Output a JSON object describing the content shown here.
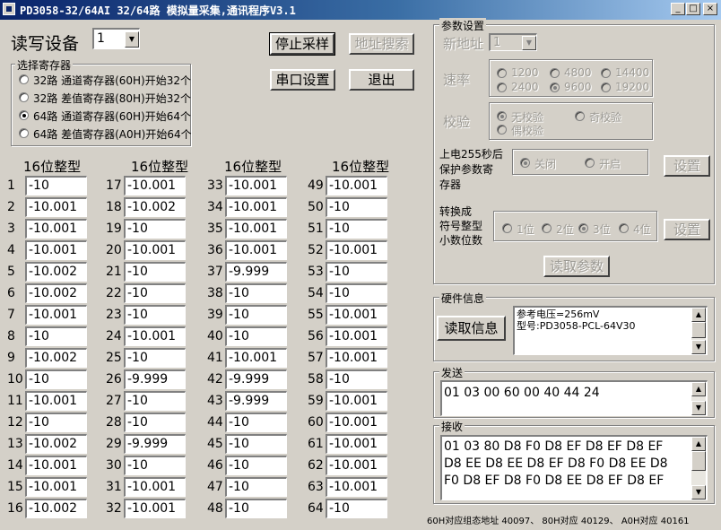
{
  "window": {
    "title": "PD3058-32/64AI 32/64路 模拟量采集,通讯程序V3.1",
    "min_label": "_",
    "max_label": "□",
    "close_label": "×"
  },
  "device": {
    "label": "读写设备",
    "value": "1"
  },
  "buttons": {
    "stop": "停止采样",
    "search": "地址搜索",
    "serial": "串口设置",
    "exit": "退出"
  },
  "register_group": {
    "title": "选择寄存器",
    "options": [
      "32路 通道寄存器(60H)开始32个",
      "32路 差值寄存器(80H)开始32个",
      "64路 通道寄存器(60H)开始64个",
      "64路 差值寄存器(A0H)开始64个"
    ],
    "selected_index": 2
  },
  "channels": {
    "header": "16位整型",
    "columns": [
      {
        "rows": [
          {
            "n": "1",
            "v": "-10"
          },
          {
            "n": "2",
            "v": "-10.001"
          },
          {
            "n": "3",
            "v": "-10.001"
          },
          {
            "n": "4",
            "v": "-10.001"
          },
          {
            "n": "5",
            "v": "-10.002"
          },
          {
            "n": "6",
            "v": "-10.002"
          },
          {
            "n": "7",
            "v": "-10.001"
          },
          {
            "n": "8",
            "v": "-10"
          },
          {
            "n": "9",
            "v": "-10.002"
          },
          {
            "n": "10",
            "v": "-10"
          },
          {
            "n": "11",
            "v": "-10.001"
          },
          {
            "n": "12",
            "v": "-10"
          },
          {
            "n": "13",
            "v": "-10.002"
          },
          {
            "n": "14",
            "v": "-10.001"
          },
          {
            "n": "15",
            "v": "-10.001"
          },
          {
            "n": "16",
            "v": "-10.002"
          }
        ]
      },
      {
        "rows": [
          {
            "n": "17",
            "v": "-10.001"
          },
          {
            "n": "18",
            "v": "-10.002"
          },
          {
            "n": "19",
            "v": "-10"
          },
          {
            "n": "20",
            "v": "-10.001"
          },
          {
            "n": "21",
            "v": "-10"
          },
          {
            "n": "22",
            "v": "-10"
          },
          {
            "n": "23",
            "v": "-10"
          },
          {
            "n": "24",
            "v": "-10.001"
          },
          {
            "n": "25",
            "v": "-10"
          },
          {
            "n": "26",
            "v": "-9.999"
          },
          {
            "n": "27",
            "v": "-10"
          },
          {
            "n": "28",
            "v": "-10"
          },
          {
            "n": "29",
            "v": "-9.999"
          },
          {
            "n": "30",
            "v": "-10"
          },
          {
            "n": "31",
            "v": "-10.001"
          },
          {
            "n": "32",
            "v": "-10.001"
          }
        ]
      },
      {
        "rows": [
          {
            "n": "33",
            "v": "-10.001"
          },
          {
            "n": "34",
            "v": "-10.001"
          },
          {
            "n": "35",
            "v": "-10.001"
          },
          {
            "n": "36",
            "v": "-10.001"
          },
          {
            "n": "37",
            "v": "-9.999"
          },
          {
            "n": "38",
            "v": "-10"
          },
          {
            "n": "39",
            "v": "-10"
          },
          {
            "n": "40",
            "v": "-10"
          },
          {
            "n": "41",
            "v": "-10.001"
          },
          {
            "n": "42",
            "v": "-9.999"
          },
          {
            "n": "43",
            "v": "-9.999"
          },
          {
            "n": "44",
            "v": "-10"
          },
          {
            "n": "45",
            "v": "-10"
          },
          {
            "n": "46",
            "v": "-10"
          },
          {
            "n": "47",
            "v": "-10"
          },
          {
            "n": "48",
            "v": "-10"
          }
        ]
      },
      {
        "rows": [
          {
            "n": "49",
            "v": "-10.001"
          },
          {
            "n": "50",
            "v": "-10"
          },
          {
            "n": "51",
            "v": "-10"
          },
          {
            "n": "52",
            "v": "-10.001"
          },
          {
            "n": "53",
            "v": "-10"
          },
          {
            "n": "54",
            "v": "-10"
          },
          {
            "n": "55",
            "v": "-10.001"
          },
          {
            "n": "56",
            "v": "-10.001"
          },
          {
            "n": "57",
            "v": "-10.001"
          },
          {
            "n": "58",
            "v": "-10"
          },
          {
            "n": "59",
            "v": "-10.001"
          },
          {
            "n": "60",
            "v": "-10.001"
          },
          {
            "n": "61",
            "v": "-10.001"
          },
          {
            "n": "62",
            "v": "-10.001"
          },
          {
            "n": "63",
            "v": "-10.001"
          },
          {
            "n": "64",
            "v": "-10"
          }
        ]
      }
    ]
  },
  "params": {
    "title": "参数设置",
    "new_addr_label": "新地址",
    "new_addr_value": "1",
    "baud_label": "速率",
    "baud_options": [
      "1200",
      "4800",
      "14400",
      "2400",
      "9600",
      "19200"
    ],
    "baud_selected": "9600",
    "check_label": "校验",
    "check_options": [
      "无校验",
      "奇校验",
      "偶校验"
    ],
    "check_selected": "无校验",
    "protect_label_lines": [
      "上电255秒后",
      "保护参数寄",
      "存器"
    ],
    "protect_options": [
      "关闭",
      "开启"
    ],
    "protect_selected": "关闭",
    "set_label": "设置",
    "decimal_label_lines": [
      "转换成",
      "符号整型",
      "小数位数"
    ],
    "decimal_options": [
      "1位",
      "2位",
      "3位",
      "4位"
    ],
    "decimal_selected": "3位",
    "read_params": "读取参数"
  },
  "hardware": {
    "title": "硬件信息",
    "read_button": "读取信息",
    "lines": [
      "参考电压=256mV",
      "型号:PD3058-PCL-64V30"
    ]
  },
  "send": {
    "title": "发送",
    "text": "01 03 00 60 00 40 44 24"
  },
  "receive": {
    "title": "接收",
    "lines": [
      "01 03 80 D8 F0 D8 EF D8 EF D8 EF",
      "D8 EE D8 EE D8 EF D8 F0 D8 EE D8",
      "F0 D8 EF D8 F0 D8 EE D8 EF D8 EF"
    ]
  },
  "footer": "60H对应组态地址 40097、 80H对应 40129、 A0H对应 40161"
}
